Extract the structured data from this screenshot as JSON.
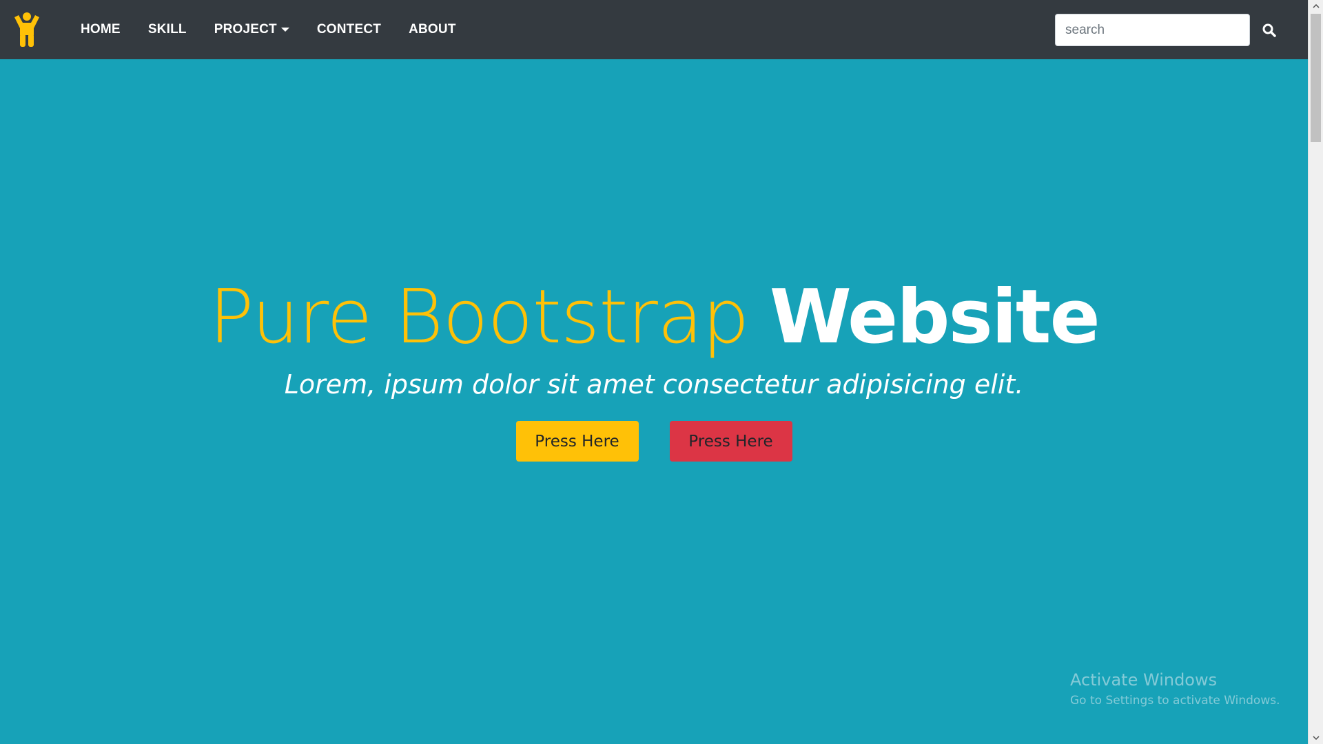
{
  "navbar": {
    "logo_icon": "person-arms-up-icon",
    "links": [
      {
        "label": "HOME"
      },
      {
        "label": "SKILL"
      },
      {
        "label": "PROJECT",
        "has_dropdown": true
      },
      {
        "label": "CONTECT"
      },
      {
        "label": "ABOUT"
      }
    ],
    "search": {
      "placeholder": "search",
      "value": "",
      "icon": "search-icon"
    }
  },
  "hero": {
    "title_light": "Pure Bootstrap",
    "title_bold": "Website",
    "subtitle": "Lorem, ipsum dolor sit amet consectetur adipisicing elit.",
    "buttons": [
      {
        "label": "Press Here",
        "color": "#ffc107"
      },
      {
        "label": "Press Here",
        "color": "#dc3545"
      }
    ]
  },
  "watermark": {
    "title": "Activate Windows",
    "subtitle": "Go to Settings to activate Windows."
  },
  "colors": {
    "navbar_bg": "#343a40",
    "hero_bg": "#17a2b8",
    "accent_yellow": "#ffc107",
    "accent_red": "#dc3545"
  }
}
